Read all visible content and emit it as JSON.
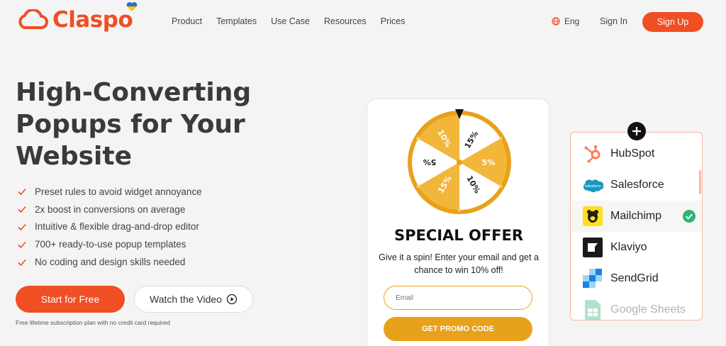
{
  "header": {
    "logo_text": "Claspo",
    "nav": [
      "Product",
      "Templates",
      "Use Case",
      "Resources",
      "Prices"
    ],
    "lang": "Eng",
    "signin": "Sign In",
    "signup": "Sign Up"
  },
  "hero": {
    "title_lines": [
      "High-Converting",
      "Popups for Your",
      "Website"
    ],
    "features": [
      "Preset rules to avoid widget annoyance",
      "2x boost in conversions on average",
      "Intuitive & flexible drag-and-drop editor",
      "700+ ready-to-use popup templates",
      "No coding and design skills needed"
    ],
    "start_btn": "Start for Free",
    "video_btn": "Watch the Video",
    "fineprint": "Free lifetime subscription plan with no credit card required"
  },
  "popup": {
    "wheel_segments": [
      "15%",
      "5%",
      "10%",
      "15%",
      "5%",
      "10%"
    ],
    "title": "SPECIAL OFFER",
    "desc": "Give it a spin! Enter your email and get a chance to win 10% off!",
    "email_placeholder": "Email",
    "cta": "GET PROMO CODE"
  },
  "integrations": {
    "items": [
      "HubSpot",
      "Salesforce",
      "Mailchimp",
      "Klaviyo",
      "SendGrid",
      "Google Sheets"
    ],
    "salesforce_logo": "salesforce"
  },
  "colors": {
    "brand": "#f04e23",
    "gold": "#e8a11a",
    "check_green": "#2bb673"
  }
}
